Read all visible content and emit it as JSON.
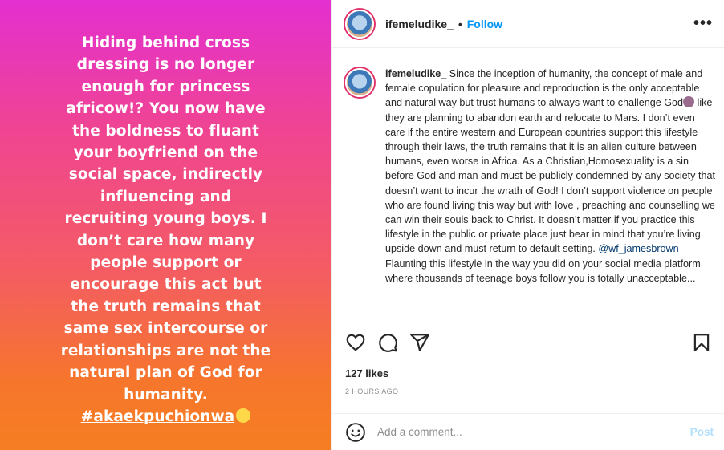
{
  "story": {
    "text": "Hiding behind cross dressing is no longer enough for princess africow!? You now have the boldness to fluant your boyfriend on the social space, indirectly influencing and recruiting young boys. I don’t care how many people support or encourage this act but the truth remains that same sex intercourse or relationships are not the natural plan of God for humanity.",
    "hashtag": "#akaekpuchionwa"
  },
  "header": {
    "username": "ifemeludike_",
    "separator": "•",
    "follow_label": "Follow",
    "more_label": "•••"
  },
  "caption": {
    "username": "ifemeludike_",
    "part1": "Since the inception of humanity, the concept of male and female copulation for pleasure and reproduction is the only acceptable and natural way but trust humans to always want to challenge God",
    "part2": "like they are planning to abandon earth and relocate to Mars. I don’t even care if the entire western and European countries support this lifestyle through their laws, the truth remains that it is an alien culture between humans, even worse in Africa. As a Christian,Homosexuality is a sin before God and man and must be publicly condemned by any society that doesn’t want to incur the wrath of God! I don’t support violence on people who are found living this way but with love , preaching and counselling we can win their souls back to Christ. It doesn’t matter if you practice this lifestyle in the public or private place just bear in mind that you’re living upside down and must return to default setting.",
    "mention": "@wf_jamesbrown",
    "part3": "Flaunting this lifestyle in the way you did on your social media platform where thousands of teenage boys follow you is totally unacceptable..."
  },
  "actions": {
    "likes": "127 likes",
    "time": "2 HOURS AGO"
  },
  "comment": {
    "placeholder": "Add a comment...",
    "post_label": "Post"
  }
}
